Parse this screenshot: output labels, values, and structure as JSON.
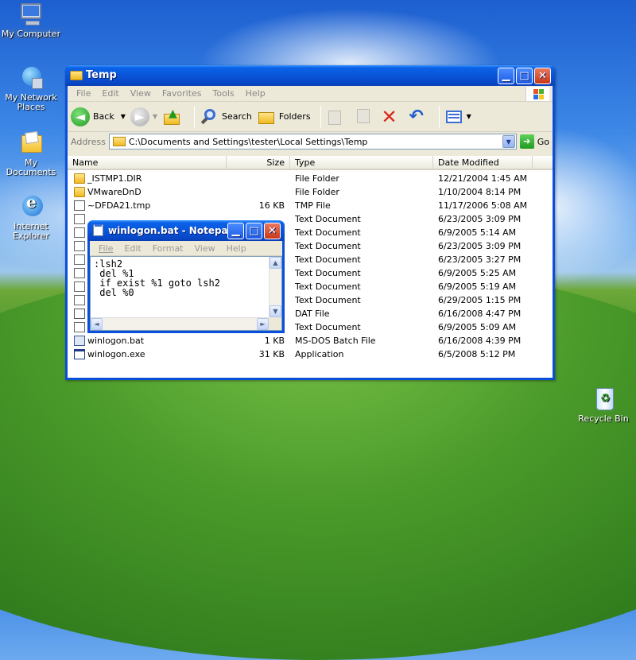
{
  "desktop": {
    "icons": [
      {
        "label": "My Computer",
        "icon": "my-computer-icon"
      },
      {
        "label": "My Network Places",
        "icon": "network-places-icon"
      },
      {
        "label": "My Documents",
        "icon": "my-documents-icon"
      },
      {
        "label": "Internet Explorer",
        "icon": "internet-explorer-icon"
      },
      {
        "label": "Recycle Bin",
        "icon": "recycle-bin-icon"
      }
    ]
  },
  "explorer": {
    "title": "Temp",
    "menu": [
      "File",
      "Edit",
      "View",
      "Favorites",
      "Tools",
      "Help"
    ],
    "toolbar": {
      "back": "Back",
      "search": "Search",
      "folders": "Folders"
    },
    "address": {
      "label": "Address",
      "value": "C:\\Documents and Settings\\tester\\Local Settings\\Temp",
      "go": "Go"
    },
    "columns": [
      "Name",
      "Size",
      "Type",
      "Date Modified"
    ],
    "files": [
      {
        "name": "_ISTMP1.DIR",
        "size": "",
        "type": "File Folder",
        "date": "12/21/2004 1:45 AM",
        "icon": "folder"
      },
      {
        "name": "VMwareDnD",
        "size": "",
        "type": "File Folder",
        "date": "1/10/2004 8:14 PM",
        "icon": "folder"
      },
      {
        "name": "~DFDA21.tmp",
        "size": "16 KB",
        "type": "TMP File",
        "date": "11/17/2006 5:08 AM",
        "icon": "tmp"
      },
      {
        "name": "",
        "size": "",
        "type": "Text Document",
        "date": "6/23/2005 3:09 PM",
        "icon": "text"
      },
      {
        "name": "",
        "size": "",
        "type": "Text Document",
        "date": "6/9/2005 5:14 AM",
        "icon": "text"
      },
      {
        "name": "",
        "size": "",
        "type": "Text Document",
        "date": "6/23/2005 3:09 PM",
        "icon": "text"
      },
      {
        "name": "",
        "size": "",
        "type": "Text Document",
        "date": "6/23/2005 3:27 PM",
        "icon": "text"
      },
      {
        "name": "",
        "size": "",
        "type": "Text Document",
        "date": "6/9/2005 5:25 AM",
        "icon": "text"
      },
      {
        "name": "",
        "size": "",
        "type": "Text Document",
        "date": "6/9/2005 5:19 AM",
        "icon": "text"
      },
      {
        "name": "",
        "size": "",
        "type": "Text Document",
        "date": "6/29/2005 1:15 PM",
        "icon": "text"
      },
      {
        "name": "",
        "size": "",
        "type": "DAT File",
        "date": "6/16/2008 4:47 PM",
        "icon": "dat"
      },
      {
        "name": "",
        "size": "",
        "type": "Text Document",
        "date": "6/9/2005 5:09 AM",
        "icon": "text"
      },
      {
        "name": "winlogon.bat",
        "size": "1 KB",
        "type": "MS-DOS Batch File",
        "date": "6/16/2008 4:39 PM",
        "icon": "bat"
      },
      {
        "name": "winlogon.exe",
        "size": "31 KB",
        "type": "Application",
        "date": "6/5/2008 5:12 PM",
        "icon": "exe"
      }
    ]
  },
  "notepad": {
    "title": "winlogon.bat - Notepad",
    "menu": [
      "File",
      "Edit",
      "Format",
      "View",
      "Help"
    ],
    "content": ":lsh2\n del %1\n if exist %1 goto lsh2\n del %0"
  },
  "colors": {
    "titlebar": "#0a54d8",
    "desktop_sky": "#3b86e6",
    "desktop_grass": "#3f8f22"
  }
}
